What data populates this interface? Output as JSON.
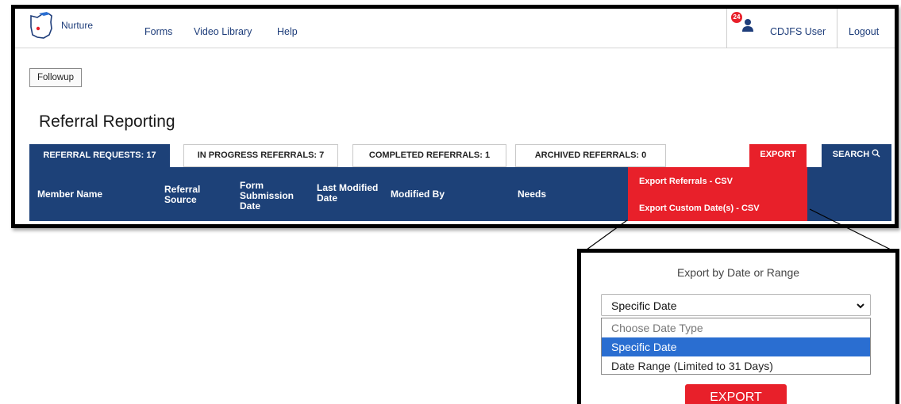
{
  "app": {
    "brand": "Nurture",
    "nav": [
      "Forms",
      "Video Library",
      "Help"
    ],
    "notification_count": "24",
    "user_name": "CDJFS User",
    "logout_label": "Logout"
  },
  "followup_label": "Followup",
  "page_title": "Referral Reporting",
  "tabs": [
    {
      "label": "REFERRAL REQUESTS: 17",
      "active": true
    },
    {
      "label": "IN PROGRESS REFERRALS: 7",
      "active": false
    },
    {
      "label": "COMPLETED REFERRALS: 1",
      "active": false
    },
    {
      "label": "ARCHIVED REFERRALS: 0",
      "active": false
    }
  ],
  "export_label": "EXPORT",
  "search_label": "SEARCH",
  "export_menu": [
    "Export Referrals - CSV",
    "Export Custom Date(s) - CSV"
  ],
  "columns": {
    "member_name": "Member Name",
    "referral_source": [
      "Referral",
      "Source"
    ],
    "form_submission_date": [
      "Form",
      "Submission",
      "Date"
    ],
    "last_modified_date": [
      "Last Modified",
      "Date"
    ],
    "modified_by": "Modified By",
    "needs": "Needs"
  },
  "zoom": {
    "title": "Export by Date or Range",
    "selected_value": "Specific Date",
    "options": [
      "Choose Date Type",
      "Specific Date",
      "Date Range (Limited to 31 Days)"
    ],
    "export_label": "EXPORT"
  },
  "colors": {
    "navy": "#1d4178",
    "red": "#e8202a",
    "highlight": "#2a6ed1"
  },
  "icons": [
    "ohio-logo-icon",
    "user-icon",
    "search-icon",
    "chevron-down-icon"
  ]
}
